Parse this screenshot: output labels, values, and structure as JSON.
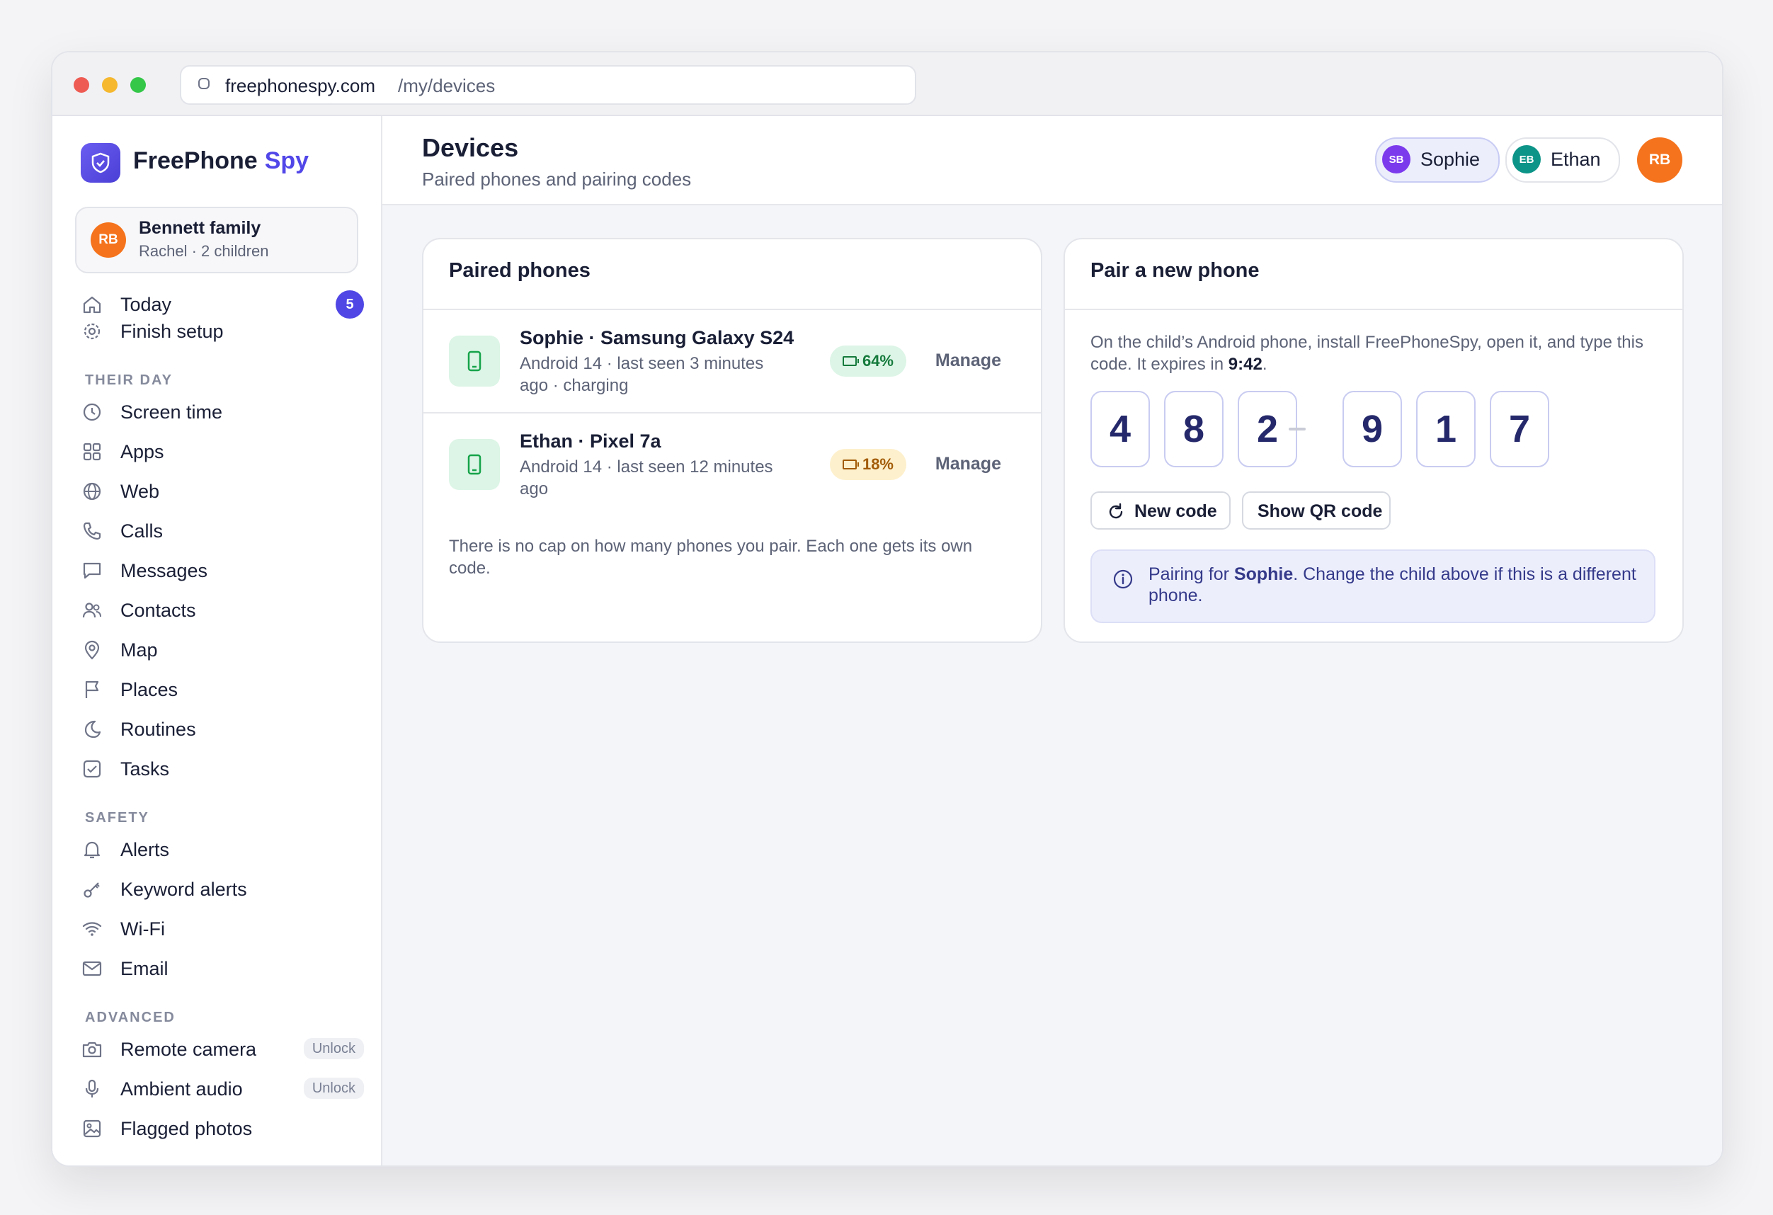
{
  "browser": {
    "host": "freephonespy.com",
    "path": "/my/devices",
    "traffic_lights": [
      "#ee5b52",
      "#f5b82e",
      "#34c748"
    ]
  },
  "brand": {
    "name": "FreePhone",
    "accent": "Spy",
    "accent_color": "#5146e8"
  },
  "family": {
    "initials": "RB",
    "name": "Bennett family",
    "sub": "Rachel · 2 children"
  },
  "nav": {
    "today": {
      "label": "Today",
      "badge": "5",
      "icon": "home-icon"
    },
    "finish_setup": {
      "label": "Finish setup",
      "icon": "gear-icon"
    },
    "section_their_day": "THEIR DAY",
    "screen_time": {
      "label": "Screen time",
      "icon": "clock-icon"
    },
    "apps": {
      "label": "Apps",
      "icon": "grid-icon"
    },
    "web": {
      "label": "Web",
      "icon": "globe-icon"
    },
    "calls": {
      "label": "Calls",
      "icon": "phone-icon"
    },
    "messages": {
      "label": "Messages",
      "icon": "chat-icon"
    },
    "contacts": {
      "label": "Contacts",
      "icon": "users-icon"
    },
    "map": {
      "label": "Map",
      "icon": "pin-icon"
    },
    "places": {
      "label": "Places",
      "icon": "flag-icon"
    },
    "routines": {
      "label": "Routines",
      "icon": "moon-icon"
    },
    "tasks": {
      "label": "Tasks",
      "icon": "checkbox-icon"
    },
    "section_safety": "SAFETY",
    "alerts": {
      "label": "Alerts",
      "icon": "bell-icon"
    },
    "keyword_alerts": {
      "label": "Keyword alerts",
      "icon": "key-icon"
    },
    "wifi": {
      "label": "Wi-Fi",
      "icon": "wifi-icon"
    },
    "email": {
      "label": "Email",
      "icon": "mail-icon"
    },
    "section_advanced": "ADVANCED",
    "remote_camera": {
      "label": "Remote camera",
      "tag": "Unlock",
      "icon": "camera-icon"
    },
    "ambient_audio": {
      "label": "Ambient audio",
      "tag": "Unlock",
      "icon": "mic-icon"
    },
    "flagged_photos": {
      "label": "Flagged photos",
      "icon": "image-icon"
    }
  },
  "header": {
    "title": "Devices",
    "subtitle": "Paired phones and pairing codes",
    "children": [
      {
        "initials": "SB",
        "name": "Sophie",
        "color": "#7c3aed",
        "selected": true
      },
      {
        "initials": "EB",
        "name": "Ethan",
        "color": "#0d9488",
        "selected": false
      }
    ],
    "user_initials": "RB"
  },
  "paired": {
    "title": "Paired phones",
    "phones": [
      {
        "name": "Sophie · Samsung Galaxy S24",
        "sub": "Android 14 · last seen 3 minutes ago · charging",
        "battery": "64%",
        "manage": "Manage"
      },
      {
        "name": "Ethan · Pixel 7a",
        "sub": "Android 14 · last seen 12 minutes ago",
        "battery": "18%",
        "manage": "Manage"
      }
    ],
    "note": "There is no cap on how many phones you pair. Each one gets its own code."
  },
  "pair_new": {
    "title": "Pair a new phone",
    "instruction": "On the child’s Android phone, install FreePhoneSpy, open it, and type this code. It expires in ",
    "expires": "9:42",
    "instruction_end": ".",
    "code": [
      "4",
      "8",
      "2",
      "9",
      "1",
      "7"
    ],
    "new_code": "New code",
    "show_qr": "Show QR code",
    "info_prefix": "Pairing for ",
    "info_child": "Sophie",
    "info_suffix": ". Change the child above if this is a different phone."
  }
}
